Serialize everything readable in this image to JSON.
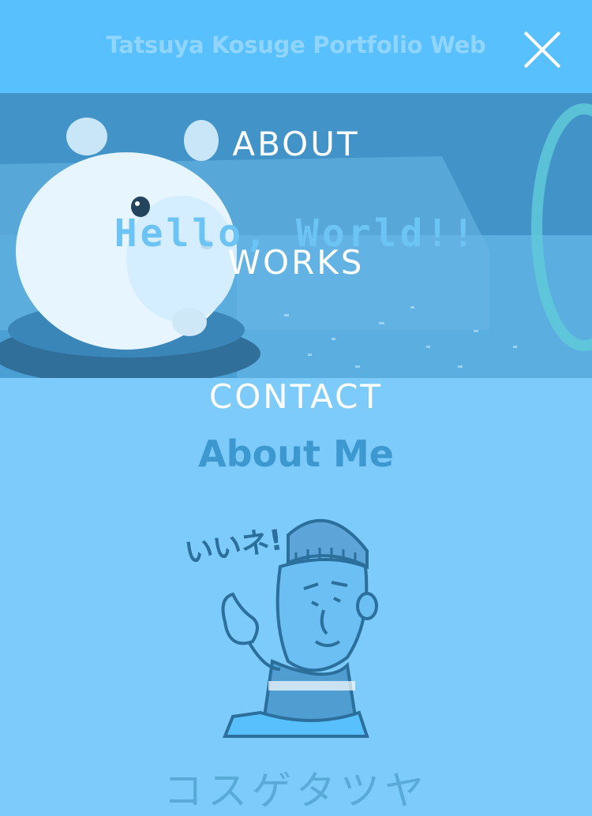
{
  "header": {
    "site_title": "Tatsuya Kosuge Portfolio Web"
  },
  "hero": {
    "title": "Hello, World!!",
    "image": "hamster-photo"
  },
  "about": {
    "title": "About Me",
    "illustration": "thumbs-up-character",
    "illustration_text": "いいネ!",
    "name": "コスゲタツヤ"
  },
  "menu": {
    "items": [
      {
        "label": "ABOUT"
      },
      {
        "label": "WORKS"
      },
      {
        "label": "CONTACT"
      }
    ],
    "close_icon": "close-icon"
  },
  "colors": {
    "header_bg": "#58c0fd",
    "page_bg": "#7ccbfb",
    "hero_tint": "#4a9fd3",
    "menu_text": "#ffffff",
    "accent_title": "#3c98cf"
  }
}
